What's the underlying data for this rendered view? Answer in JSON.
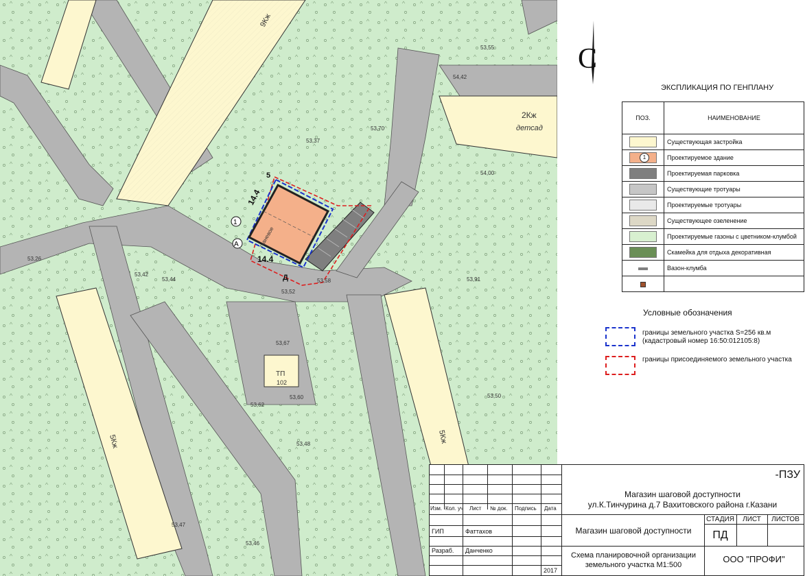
{
  "map": {
    "building_labels": {
      "b1": "9Кж",
      "b2": "5Кж",
      "b3": "5Кж",
      "b4": "2Кж",
      "b4b": "детсад",
      "b5": "ТП",
      "b5b": "102"
    },
    "dimension_top": "14.4",
    "dimension_bottom": "14.4",
    "marker_num": "1",
    "marker_a": "А",
    "marker_5": "5",
    "marker_d": "Д",
    "shop_label": "тканевое",
    "colors": {
      "map_bg": "#cfeccc",
      "roads": "#b4b4b4",
      "existing_building": "#fdf7cf",
      "new_building": "#f4b08a",
      "parking": "#7f7f7f",
      "blue_border": "#1a33cc",
      "red_border": "#dd1e1e"
    },
    "elevations": [
      "53,42",
      "53,58",
      "53,52",
      "53,67",
      "53,62",
      "53,60",
      "53,37",
      "53,70",
      "53,91",
      "54,00",
      "53,55",
      "54,42",
      "53,48",
      "53,44",
      "53,47",
      "53,46",
      "53,50",
      "53,26"
    ]
  },
  "north_arrow": "С",
  "explication": {
    "title": "ЭКСПЛИКАЦИЯ ПО ГЕНПЛАНУ",
    "col_pos": "ПОЗ.",
    "col_name": "НАИМЕНОВАНИЕ",
    "rows": [
      {
        "name": "Существующая застройка",
        "swatch": "#fdf7cf"
      },
      {
        "name": "Проектируемое здание",
        "swatch": "#f4b08a",
        "num": "1"
      },
      {
        "name": "Проектируемая парковка",
        "swatch": "#7f7f7f"
      },
      {
        "name": "Существующие тротуары",
        "swatch": "#c6c6c6"
      },
      {
        "name": "Проектируемые тротуары",
        "swatch": "#e9e9e9"
      },
      {
        "name": "Существующее озеленение",
        "swatch": "#ddd8c6"
      },
      {
        "name": "Проектируемые газоны с цветником-клумбой",
        "swatch": "#d8f0d0"
      },
      {
        "name": "Скамейка для отдыха декоративная",
        "swatch": "#6a8f56"
      },
      {
        "name": "Вазон-клумба",
        "swatch": "#808080"
      },
      {
        "name": "",
        "swatch": "#a0522d"
      }
    ]
  },
  "conditions": {
    "title": "Условные обозначения",
    "blue_line1": "границы земельного участка S=256 кв.м",
    "blue_line2": "(кадастровый номер 16:50:012105:8)",
    "red_line": "границы присоединяемого земельного участка"
  },
  "title_block": {
    "code": "-ПЗУ",
    "project_line1": "Магазин шаговой доступности",
    "project_line2": "ул.К.Тинчурина д.7 Вахитовского района г.Казани",
    "headers": [
      "Изм.",
      "Кол. уч",
      "Лист",
      "№ док.",
      "Подпись",
      "Дата"
    ],
    "gip_role": "ГИП",
    "gip_name": "Фаттахов",
    "dev_role": "Разраб.",
    "dev_name": "Данченко",
    "year": "2017",
    "object_name": "Магазин шаговой доступности",
    "stage_label": "СТАДИЯ",
    "sheet_label": "ЛИСТ",
    "sheets_label": "ЛИСТОВ",
    "stage_value": "ПД",
    "drawing_line1": "Схема планировочной организации",
    "drawing_line2": "земельного участка М1:500",
    "company": "ООО \"ПРОФИ\""
  }
}
